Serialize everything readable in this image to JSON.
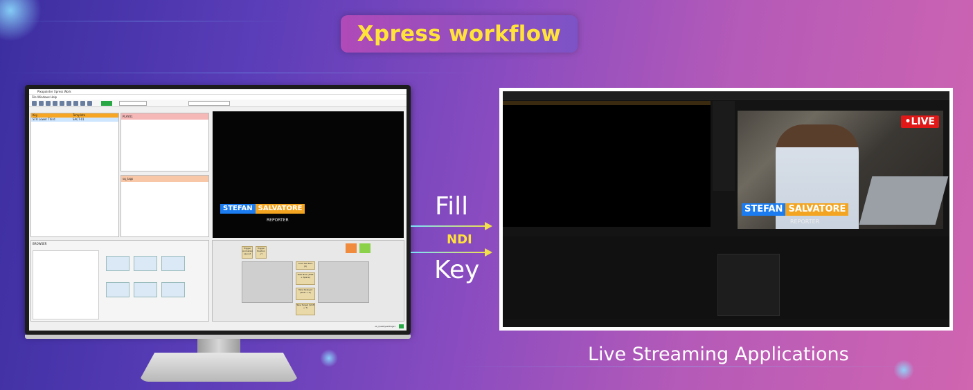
{
  "header": {
    "title": "Xpress workflow"
  },
  "connectors": {
    "fill": "Fill",
    "ndi": "NDI",
    "key": "Key"
  },
  "caption": "Live Streaming Applications",
  "software": {
    "window_title": "Pixapointer Xpress Work",
    "menu": "File   Windows   Help",
    "columns": {
      "key": "Key",
      "template": "Template"
    },
    "row": {
      "key": "STR Lower Third",
      "template": "SACT-01"
    },
    "playlist": {
      "p1": "PLAY01",
      "p2": "sq_tags"
    },
    "browser_label": "BROWSER",
    "cells": [
      "Trigger Animation Layout",
      "Trigger Position +Y",
      "Load Set Item (0)",
      "Take Now (Shift + Space)",
      "Take Delayed (Shift + K)",
      "Take Target (Shift + T)"
    ],
    "status": "ok_Qualitysettings1"
  },
  "lower_third": {
    "first": "STEFAN",
    "last": "SALVATORE",
    "role": "REPORTER"
  },
  "live_badge": "•LIVE",
  "colors": {
    "accent_yellow": "#ffe23a",
    "blue": "#1a7cf0",
    "orange": "#f3a521",
    "live_red": "#e11818"
  }
}
